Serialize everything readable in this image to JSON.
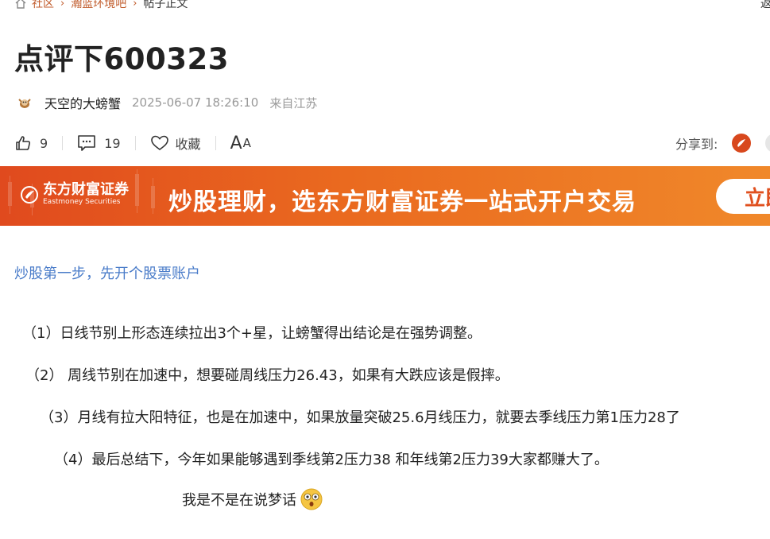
{
  "breadcrumb": {
    "items": [
      "社区",
      "瀚蓝环境吧"
    ],
    "current": "帖子正文",
    "back_label": "返"
  },
  "post": {
    "title": "点评下600323",
    "author": "天空的大螃蟹",
    "time": "2025-06-07 18:26:10",
    "location": "来自江苏"
  },
  "actions": {
    "likes": "9",
    "comments": "19",
    "favorite_label": "收藏",
    "font_label_big": "A",
    "font_label_small": "A",
    "share_label": "分享到:"
  },
  "banner": {
    "brand_cn": "东方财富证券",
    "brand_en": "Eastmoney Securities",
    "slogan": "炒股理财，选东方财富证券一站式开户交易",
    "cta": "立即"
  },
  "content": {
    "promo_link": "炒股第一步，先开个股票账户",
    "paragraphs": [
      "（1）日线节别上形态连续拉出3个+星，让螃蟹得出结论是在强势调整。",
      "（2） 周线节别在加速中，想要碰周线压力26.43，如果有大跌应该是假摔。",
      "（3）月线有拉大阳特征，也是在加速中，如果放量突破25.6月线压力，就要去季线压力第1压力28了",
      "（4）最后总结下，今年如果能够遇到季线第2压力38 和年线第2压力39大家都赚大了。",
      "我是不是在说梦话"
    ]
  },
  "colors": {
    "accent": "#c05a2a",
    "link": "#4a7cc9",
    "banner_start": "#e04a1e",
    "banner_end": "#f0882a"
  },
  "icons": [
    "home-icon",
    "chevron-right-icon",
    "avatar-icon",
    "thumb-up-icon",
    "comment-icon",
    "heart-icon",
    "weibo-icon",
    "eastmoney-logo-icon",
    "shock-emoji-icon"
  ]
}
